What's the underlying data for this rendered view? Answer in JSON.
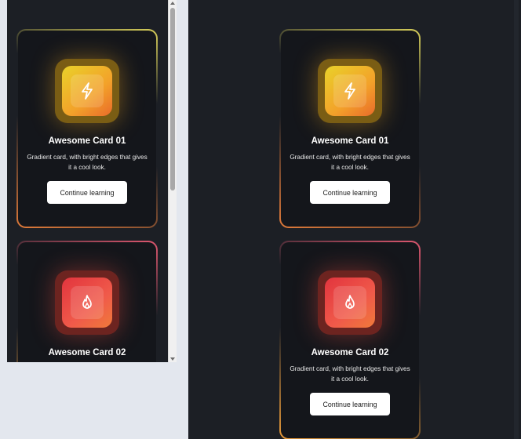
{
  "cards": [
    {
      "title": "Awesome Card 01",
      "description": "Gradient card, with bright edges that gives it a cool look.",
      "button_label": "Continue learning",
      "icon": "lightning-icon"
    },
    {
      "title": "Awesome Card 02",
      "description": "Gradient card, with bright edges that gives it a cool look.",
      "button_label": "Continue learning",
      "icon": "flame-icon"
    }
  ],
  "colors": {
    "background": "#1c1f25",
    "card_background": "#14161b",
    "button_background": "#ffffff",
    "card1_edge_top": "#d8cf5a",
    "card1_edge_bottom": "#e07a3a",
    "card2_edge_top": "#e05870",
    "card2_edge_bottom": "#e89a3a"
  }
}
